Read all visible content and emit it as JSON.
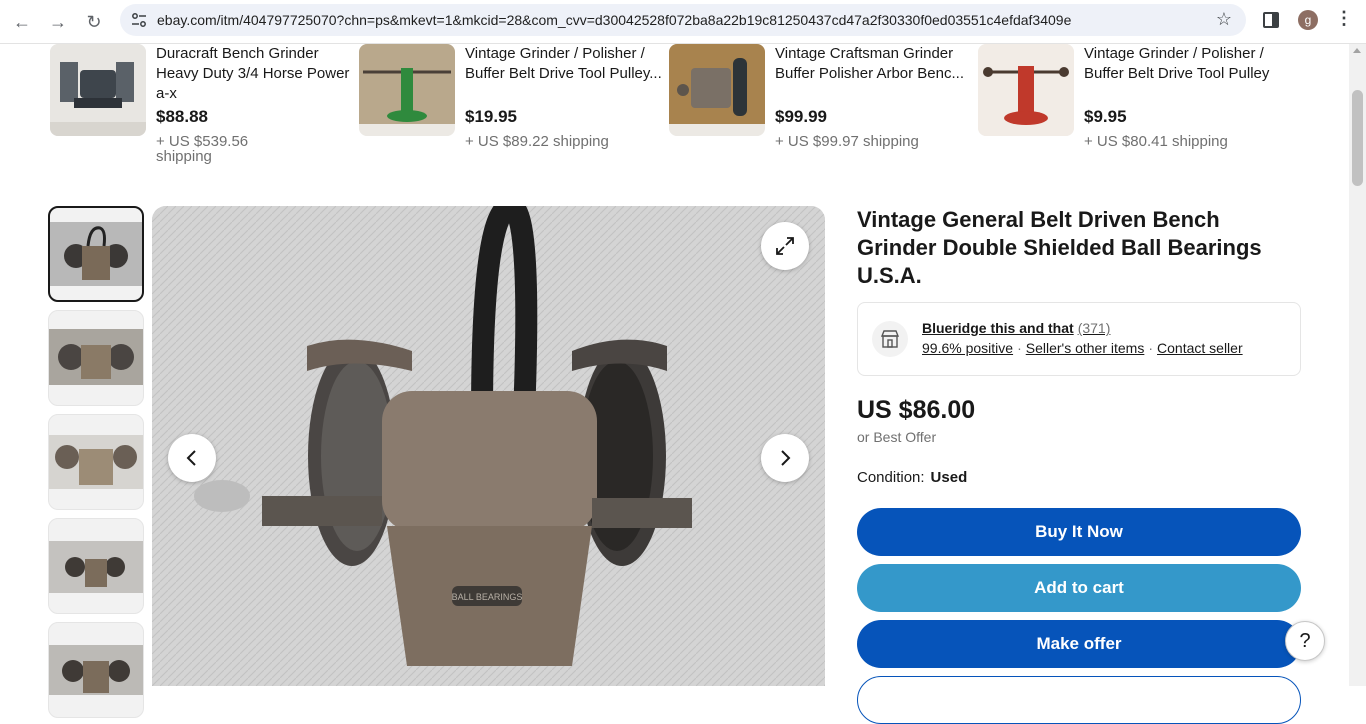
{
  "browser": {
    "url": "ebay.com/itm/404797725070?chn=ps&mkevt=1&mkcid=28&com_cvv=d30042528f072ba8a22b19c81250437cd47a2f30330f0ed03551c4efdaf3409e",
    "profile_initial": "g"
  },
  "related_items": [
    {
      "title": "Duracraft Bench Grinder Heavy Duty 3/4 Horse Power a-x",
      "price": "$88.88",
      "shipping": "+ US $539.56 shipping"
    },
    {
      "title": "Vintage Grinder / Polisher / Buffer Belt Drive Tool Pulley...",
      "price": "$19.95",
      "shipping": "+ US $89.22 shipping"
    },
    {
      "title": "Vintage Craftsman Grinder Buffer Polisher Arbor Benc...",
      "price": "$99.99",
      "shipping": "+ US $99.97 shipping"
    },
    {
      "title": "Vintage Grinder / Polisher / Buffer Belt Drive Tool Pulley",
      "price": "$9.95",
      "shipping": "+ US $80.41 shipping"
    }
  ],
  "listing": {
    "title": "Vintage General Belt Driven Bench Grinder Double Shielded Ball Bearings U.S.A.",
    "seller": {
      "name": "Blueridge this and that",
      "count": "(371)",
      "positive": "99.6% positive",
      "other_items": "Seller's other items",
      "contact": "Contact seller"
    },
    "price": "US $86.00",
    "best_offer": "or Best Offer",
    "condition_label": "Condition:",
    "condition_value": "Used",
    "buy_now": "Buy It Now",
    "add_to_cart": "Add to cart",
    "make_offer": "Make offer"
  },
  "help_label": "?",
  "colors": {
    "primary": "#0654ba",
    "secondary": "#3498ca",
    "text": "#191919",
    "muted": "#707070"
  }
}
